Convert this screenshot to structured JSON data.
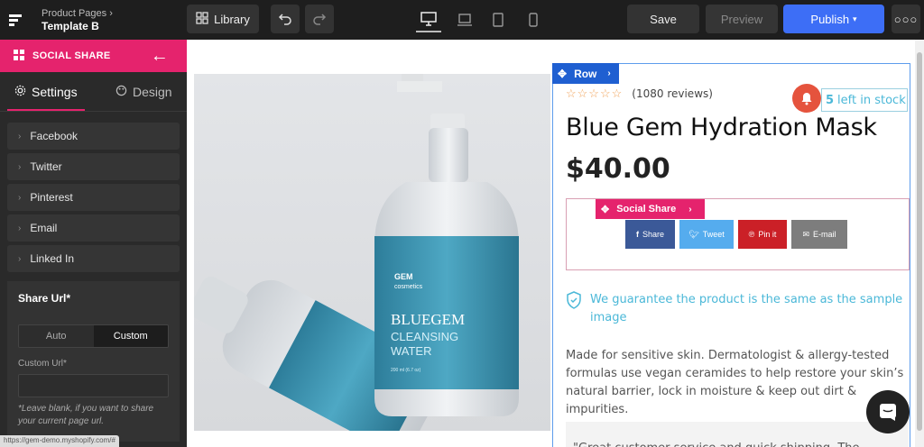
{
  "topbar": {
    "breadcrumb_parent": "Product Pages",
    "page_name": "Template B",
    "library_label": "Library",
    "save_label": "Save",
    "preview_label": "Preview",
    "publish_label": "Publish",
    "publish_color": "#3d6ef6"
  },
  "sidebar": {
    "header": "SOCIAL SHARE",
    "accent_color": "#e5236d",
    "tab_settings": "Settings",
    "tab_design": "Design",
    "items": [
      {
        "label": "Facebook"
      },
      {
        "label": "Twitter"
      },
      {
        "label": "Pinterest"
      },
      {
        "label": "Email"
      },
      {
        "label": "Linked In"
      }
    ],
    "share_url_title": "Share Url*",
    "toggle_auto": "Auto",
    "toggle_custom": "Custom",
    "toggle_selected": "Custom",
    "custom_url_label": "Custom Url*",
    "custom_url_value": "",
    "note": "*Leave blank, if you want to share your current page url."
  },
  "status_url": "https://gem-demo.myshopify.com/#",
  "canvas": {
    "row_tag": "Row",
    "rating_filled": 0,
    "rating_max": 5,
    "reviews": "(1080 reviews)",
    "stock_count": "5",
    "stock_text": "left in stock",
    "title": "Blue Gem Hydration Mask",
    "price": "$40.00",
    "social_tag": "Social Share",
    "share_buttons": [
      {
        "label": "Share",
        "icon": "facebook-icon",
        "color": "#3b5998"
      },
      {
        "label": "Tweet",
        "icon": "twitter-icon",
        "color": "#55acee"
      },
      {
        "label": "Pin it",
        "icon": "pinterest-icon",
        "color": "#cb2027"
      },
      {
        "label": "E-mail",
        "icon": "email-icon",
        "color": "#7d7d7d"
      }
    ],
    "guarantee": "We guarantee the product is the same as the sample image",
    "description": "Made for sensitive skin. Dermatologist & allergy-tested formulas use vegan ceramides to help restore your skin’s natural barrier, lock in moisture & keep out dirt & impurities.",
    "quote": "\"Great customer service and quick shipping. The",
    "product_image": {
      "bottle_brand": "GEM",
      "bottle_brand_sub": "cosmetics",
      "bottle_name": "BLUEGEM",
      "bottle_sub1": "CLEANSING",
      "bottle_sub2": "WATER",
      "bottle_volume": "200 ml (6.7 oz)"
    }
  }
}
